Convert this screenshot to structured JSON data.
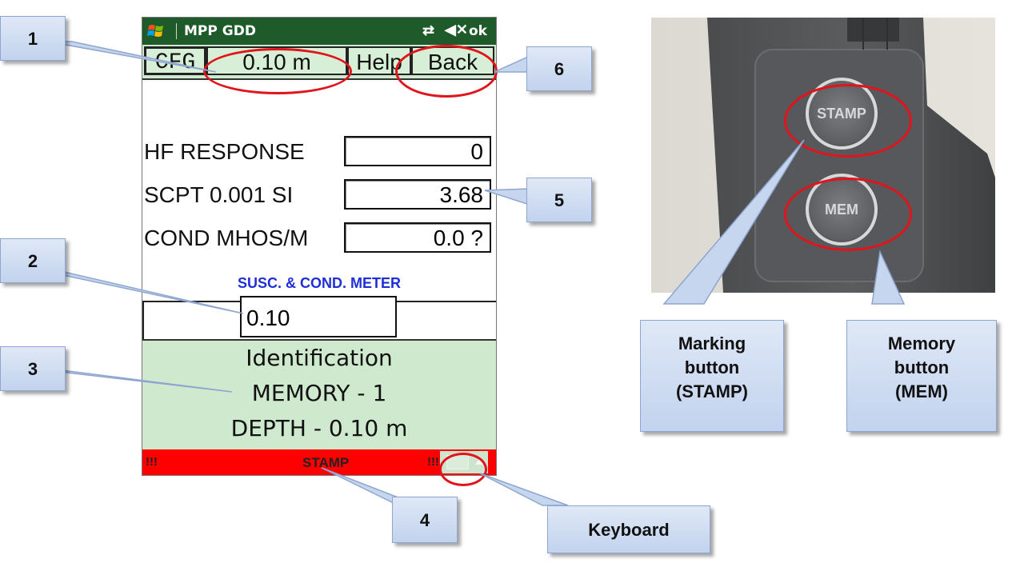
{
  "phone": {
    "titlebar": {
      "app_title": "MPP GDD",
      "ok_label": "ok",
      "logo_icon": "windows-flag-icon",
      "sync_icon": "sync-arrows-icon",
      "speaker_icon": "speaker-muted-icon"
    },
    "menubar": {
      "cfg_label": "CFG",
      "distance_label": "0.10 m",
      "help_label": "Help",
      "back_label": "Back"
    },
    "readings": [
      {
        "label": "HF  RESPONSE",
        "value": "0"
      },
      {
        "label": "SCPT  0.001 SI",
        "value": "3.68"
      },
      {
        "label": "COND MHOS/M",
        "value": "0.0 ?"
      }
    ],
    "meter_title": "SUSC. & COND.  METER",
    "depth_input_value": "0.10",
    "identification": {
      "line1": "Identification",
      "line2": "MEMORY - 1",
      "line3": "DEPTH - 0.10 m"
    },
    "stampbar": {
      "left_marks": "!!!",
      "label": "STAMP",
      "right_marks": "!!!",
      "keyboard_icon": "keyboard-icon"
    }
  },
  "device": {
    "stamp_button_label": "STAMP",
    "mem_button_label": "MEM"
  },
  "callouts": {
    "c1": "1",
    "c2": "2",
    "c3": "3",
    "c4": "4",
    "c5": "5",
    "c6": "6",
    "keyboard": "Keyboard",
    "marking": [
      "Marking",
      "button",
      "(STAMP)"
    ],
    "memory": [
      "Memory",
      "button",
      "(MEM)"
    ]
  },
  "colors": {
    "title_bar": "#1f5a2a",
    "menu_green": "#cfe9cf",
    "stamp_bar": "#ff0000",
    "highlight_ellipse": "#e1141c",
    "meter_title": "#1f2fd6"
  }
}
